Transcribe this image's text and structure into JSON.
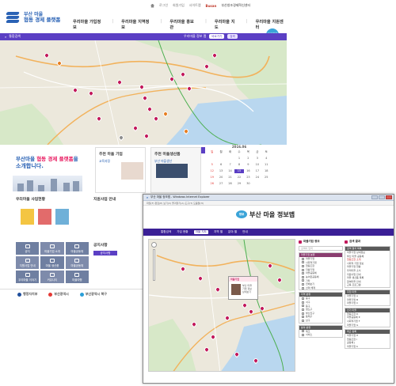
{
  "back": {
    "util_links": [
      "로그인",
      "회원가입",
      "사이트맵"
    ],
    "brand_top": "Busan",
    "brand_label": "부산창조경제혁신센터",
    "logo": {
      "line1": "부산 마을",
      "line2": "협동 경제 플랫폼"
    },
    "gnb": [
      "우리마을 가입정보",
      "우리마을 지역정보",
      "우리마을 홍보관",
      "우리마을 지도",
      "우리마을 지원센터"
    ],
    "badge": "바로가기",
    "bar_left": "통합검색",
    "bar_right": {
      "label": "우리마을 정보 맵",
      "pill1": "바로가기",
      "pill2": "검색"
    },
    "hero": {
      "line1_a": "부산마을 ",
      "line1_b": "협동 경제 플랫폼",
      "line1_c": "을",
      "line2": "소개합니다."
    },
    "panel1": {
      "title": "추천 마을 기업",
      "sub": "교육과정"
    },
    "panel2": {
      "title": "추천 마을생산품",
      "sub": "부산 마을생산"
    },
    "calendar": {
      "header": "2016.06",
      "days": [
        "일",
        "월",
        "화",
        "수",
        "목",
        "금",
        "토"
      ],
      "dates": [
        "",
        "",
        "",
        "1",
        "2",
        "3",
        "4",
        "5",
        "6",
        "7",
        "8",
        "9",
        "10",
        "11",
        "12",
        "13",
        "14",
        "15",
        "16",
        "17",
        "18",
        "19",
        "20",
        "21",
        "22",
        "23",
        "24",
        "25",
        "26",
        "27",
        "28",
        "29",
        "30",
        "",
        ""
      ],
      "highlight": "15"
    },
    "box2_title": "우리마을 사업현황",
    "box3_title": "지원사업 안내",
    "tiles": [
      "공지",
      "마을기업 소개",
      "마을공동체",
      "지원사업 안내",
      "마을 생산품",
      "마을공동체",
      "우리마을 이야기",
      "커뮤니티",
      "마을여행"
    ],
    "box4_title": "공지사항",
    "box4_tab": "공지사항",
    "footer": [
      "행정자치부",
      "부산광역시",
      "부산광역시 북구"
    ]
  },
  "front": {
    "window_title": "부산 마을 정보맵 - Windows Internet Explorer",
    "menu": "파일(F)  편집(E)  보기(V)  즐겨찾기(A)  도구(T)  도움말(H)",
    "logo_badge": "정보",
    "title": "부산 마을 정보맵",
    "nav": [
      "통합검색",
      "가입 현황",
      "마을 지도",
      "지역 별",
      "분야 별",
      "안내"
    ],
    "nav_active": "마을 지도",
    "popup": {
      "title": "마을기업",
      "body": "부산 마을\n기업 정보\n상세보기"
    },
    "side1": {
      "head": "마을기업 정보",
      "search_placeholder": "검색어 입력",
      "groups": [
        {
          "title": "마을기업 분류",
          "style": "m",
          "rows": [
            "마을기업",
            "사회적기업",
            "협동조합",
            "자활기업",
            "마을공동체",
            "농어촌공동체",
            "기타",
            "전체보기",
            "선택 해제"
          ]
        },
        {
          "title": "지역 분류",
          "style": "d",
          "rows": [
            "중구",
            "서구",
            "동구",
            "영도구",
            "부산진구",
            "동래구",
            "남구"
          ]
        },
        {
          "title": "분야 분류",
          "style": "d",
          "rows": [
            "제조",
            "서비스"
          ]
        }
      ]
    },
    "side2": {
      "head": "검색 결과",
      "groups": [
        {
          "title": "검색 결과 목록",
          "rows": [
            "마을기업 상세정보",
            "부산 마을 공동체",
            "협동조합 소개",
            "사회적 기업 정보",
            "마을기업 현황",
            "우리마을 소식",
            "지원사업 안내",
            "마을 생산품 목록",
            "참여마을 안내",
            "교육 프로그램"
          ]
        },
        {
          "title": "추천 마을",
          "rows": [
            "마을기업 A",
            "마을기업 B",
            "마을기업 C"
          ]
        },
        {
          "title": "인기 마을",
          "rows": [
            "협동조합 D",
            "마을공동체 E",
            "사회적기업 F",
            "마을기업 G"
          ]
        },
        {
          "title": "최근 등록",
          "rows": [
            "마을기업 H",
            "협동조합 I",
            "공동체 J",
            "마을기업 K"
          ]
        }
      ],
      "highlight_row": "협동조합 소개"
    }
  },
  "colors": {
    "purple": "#5b3fc4",
    "navy": "#3a1f96",
    "pin": "#c2185b",
    "accent_blue": "#2a62b5"
  }
}
